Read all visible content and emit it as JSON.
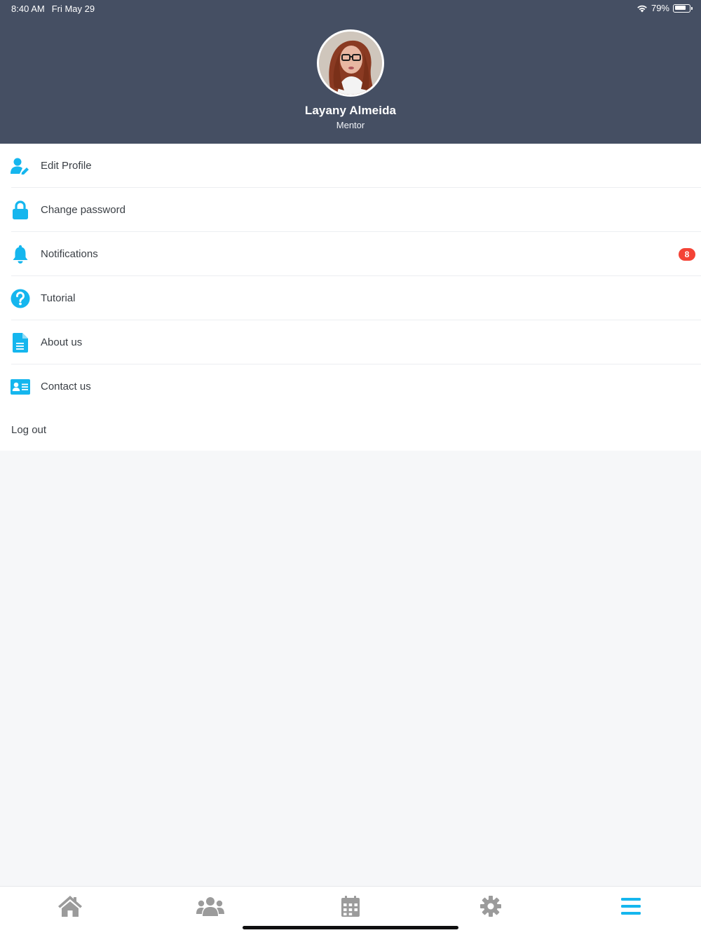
{
  "status_bar": {
    "time": "8:40 AM",
    "date": "Fri May 29",
    "battery": "79%",
    "battery_level": 0.79
  },
  "profile": {
    "name": "Layany Almeida",
    "role": "Mentor"
  },
  "menu": {
    "items": [
      {
        "label": "Edit Profile",
        "icon": "user-edit-icon"
      },
      {
        "label": "Change password",
        "icon": "lock-icon"
      },
      {
        "label": "Notifications",
        "icon": "bell-icon",
        "badge": "8"
      },
      {
        "label": "Tutorial",
        "icon": "question-circle-icon"
      },
      {
        "label": "About us",
        "icon": "document-icon"
      },
      {
        "label": "Contact us",
        "icon": "contact-card-icon"
      }
    ],
    "logout": "Log out"
  },
  "tabbar": {
    "tabs": [
      {
        "icon": "home-icon",
        "active": false
      },
      {
        "icon": "users-icon",
        "active": false
      },
      {
        "icon": "calendar-icon",
        "active": false
      },
      {
        "icon": "gear-icon",
        "active": false
      },
      {
        "icon": "menu-icon",
        "active": true
      }
    ]
  },
  "colors": {
    "header_bg": "#454f63",
    "accent": "#15b6ee",
    "badge": "#f44336",
    "tab_inactive": "#9b9b9b"
  }
}
